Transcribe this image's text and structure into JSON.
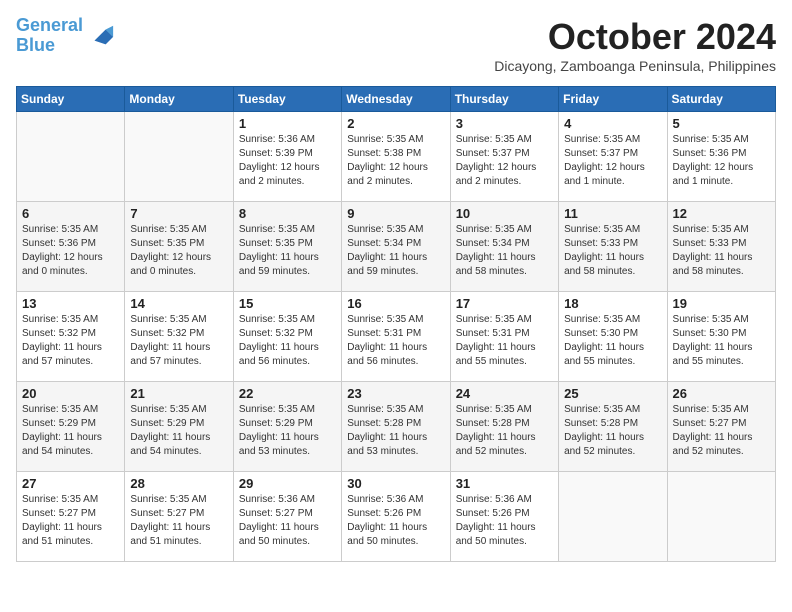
{
  "header": {
    "logo_line1": "General",
    "logo_line2": "Blue",
    "month": "October 2024",
    "location": "Dicayong, Zamboanga Peninsula, Philippines"
  },
  "days_of_week": [
    "Sunday",
    "Monday",
    "Tuesday",
    "Wednesday",
    "Thursday",
    "Friday",
    "Saturday"
  ],
  "weeks": [
    [
      {
        "day": "",
        "info": ""
      },
      {
        "day": "",
        "info": ""
      },
      {
        "day": "1",
        "info": "Sunrise: 5:36 AM\nSunset: 5:39 PM\nDaylight: 12 hours\nand 2 minutes."
      },
      {
        "day": "2",
        "info": "Sunrise: 5:35 AM\nSunset: 5:38 PM\nDaylight: 12 hours\nand 2 minutes."
      },
      {
        "day": "3",
        "info": "Sunrise: 5:35 AM\nSunset: 5:37 PM\nDaylight: 12 hours\nand 2 minutes."
      },
      {
        "day": "4",
        "info": "Sunrise: 5:35 AM\nSunset: 5:37 PM\nDaylight: 12 hours\nand 1 minute."
      },
      {
        "day": "5",
        "info": "Sunrise: 5:35 AM\nSunset: 5:36 PM\nDaylight: 12 hours\nand 1 minute."
      }
    ],
    [
      {
        "day": "6",
        "info": "Sunrise: 5:35 AM\nSunset: 5:36 PM\nDaylight: 12 hours\nand 0 minutes."
      },
      {
        "day": "7",
        "info": "Sunrise: 5:35 AM\nSunset: 5:35 PM\nDaylight: 12 hours\nand 0 minutes."
      },
      {
        "day": "8",
        "info": "Sunrise: 5:35 AM\nSunset: 5:35 PM\nDaylight: 11 hours\nand 59 minutes."
      },
      {
        "day": "9",
        "info": "Sunrise: 5:35 AM\nSunset: 5:34 PM\nDaylight: 11 hours\nand 59 minutes."
      },
      {
        "day": "10",
        "info": "Sunrise: 5:35 AM\nSunset: 5:34 PM\nDaylight: 11 hours\nand 58 minutes."
      },
      {
        "day": "11",
        "info": "Sunrise: 5:35 AM\nSunset: 5:33 PM\nDaylight: 11 hours\nand 58 minutes."
      },
      {
        "day": "12",
        "info": "Sunrise: 5:35 AM\nSunset: 5:33 PM\nDaylight: 11 hours\nand 58 minutes."
      }
    ],
    [
      {
        "day": "13",
        "info": "Sunrise: 5:35 AM\nSunset: 5:32 PM\nDaylight: 11 hours\nand 57 minutes."
      },
      {
        "day": "14",
        "info": "Sunrise: 5:35 AM\nSunset: 5:32 PM\nDaylight: 11 hours\nand 57 minutes."
      },
      {
        "day": "15",
        "info": "Sunrise: 5:35 AM\nSunset: 5:32 PM\nDaylight: 11 hours\nand 56 minutes."
      },
      {
        "day": "16",
        "info": "Sunrise: 5:35 AM\nSunset: 5:31 PM\nDaylight: 11 hours\nand 56 minutes."
      },
      {
        "day": "17",
        "info": "Sunrise: 5:35 AM\nSunset: 5:31 PM\nDaylight: 11 hours\nand 55 minutes."
      },
      {
        "day": "18",
        "info": "Sunrise: 5:35 AM\nSunset: 5:30 PM\nDaylight: 11 hours\nand 55 minutes."
      },
      {
        "day": "19",
        "info": "Sunrise: 5:35 AM\nSunset: 5:30 PM\nDaylight: 11 hours\nand 55 minutes."
      }
    ],
    [
      {
        "day": "20",
        "info": "Sunrise: 5:35 AM\nSunset: 5:29 PM\nDaylight: 11 hours\nand 54 minutes."
      },
      {
        "day": "21",
        "info": "Sunrise: 5:35 AM\nSunset: 5:29 PM\nDaylight: 11 hours\nand 54 minutes."
      },
      {
        "day": "22",
        "info": "Sunrise: 5:35 AM\nSunset: 5:29 PM\nDaylight: 11 hours\nand 53 minutes."
      },
      {
        "day": "23",
        "info": "Sunrise: 5:35 AM\nSunset: 5:28 PM\nDaylight: 11 hours\nand 53 minutes."
      },
      {
        "day": "24",
        "info": "Sunrise: 5:35 AM\nSunset: 5:28 PM\nDaylight: 11 hours\nand 52 minutes."
      },
      {
        "day": "25",
        "info": "Sunrise: 5:35 AM\nSunset: 5:28 PM\nDaylight: 11 hours\nand 52 minutes."
      },
      {
        "day": "26",
        "info": "Sunrise: 5:35 AM\nSunset: 5:27 PM\nDaylight: 11 hours\nand 52 minutes."
      }
    ],
    [
      {
        "day": "27",
        "info": "Sunrise: 5:35 AM\nSunset: 5:27 PM\nDaylight: 11 hours\nand 51 minutes."
      },
      {
        "day": "28",
        "info": "Sunrise: 5:35 AM\nSunset: 5:27 PM\nDaylight: 11 hours\nand 51 minutes."
      },
      {
        "day": "29",
        "info": "Sunrise: 5:36 AM\nSunset: 5:27 PM\nDaylight: 11 hours\nand 50 minutes."
      },
      {
        "day": "30",
        "info": "Sunrise: 5:36 AM\nSunset: 5:26 PM\nDaylight: 11 hours\nand 50 minutes."
      },
      {
        "day": "31",
        "info": "Sunrise: 5:36 AM\nSunset: 5:26 PM\nDaylight: 11 hours\nand 50 minutes."
      },
      {
        "day": "",
        "info": ""
      },
      {
        "day": "",
        "info": ""
      }
    ]
  ]
}
